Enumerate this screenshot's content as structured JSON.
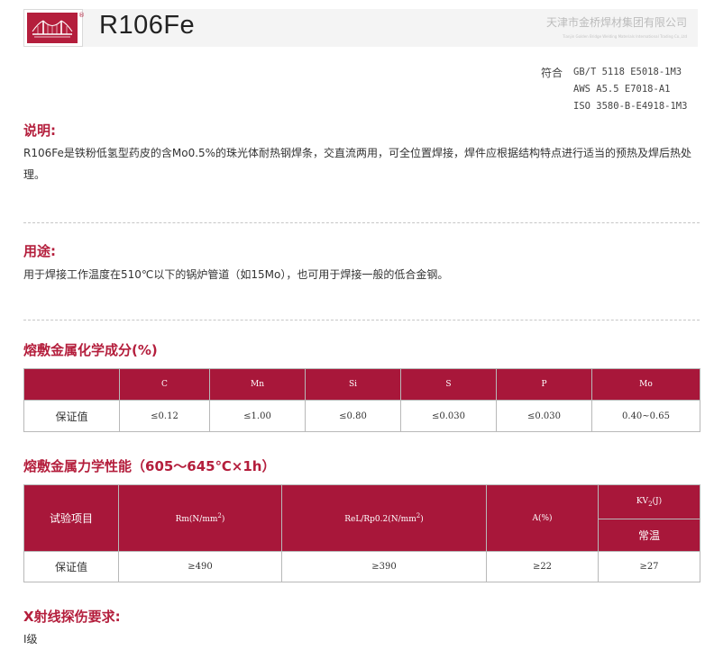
{
  "header": {
    "product_name": "R106Fe",
    "company_cn": "天津市金桥焊材集团有限公司",
    "company_en": "Tianjin Golden Bridge Welding Materials International Trading Co.,Ltd",
    "logo_color": "#b41e3c"
  },
  "standards": {
    "label": "符合",
    "lines": [
      "GB/T 5118 E5018-1M3",
      "AWS A5.5 E7018-A1",
      "ISO 3580-B-E4918-1M3"
    ]
  },
  "description": {
    "title": "说明:",
    "text": "R106Fe是铁粉低氢型药皮的含Mo0.5%的珠光体耐热钢焊条，交直流两用，可全位置焊接，焊件应根据结构特点进行适当的预热及焊后热处理。"
  },
  "usage": {
    "title": "用途:",
    "text": "用于焊接工作温度在510℃以下的锅炉管道（如15Mo），也可用于焊接一般的低合金钢。"
  },
  "chem": {
    "title": "熔敷金属化学成分(%)",
    "headers": [
      "",
      "C",
      "Mn",
      "Si",
      "S",
      "P",
      "Mo"
    ],
    "row_label": "保证值",
    "values": [
      "≤0.12",
      "≤1.00",
      "≤0.80",
      "≤0.030",
      "≤0.030",
      "0.40~0.65"
    ]
  },
  "mech": {
    "title": "熔敷金属力学性能（605～645℃×1h）",
    "col_test": "试验项目",
    "col_rm": "Rm(N/mm",
    "col_rm_sup": "2",
    "col_rm_end": ")",
    "col_rel": "ReL/Rp0.2(N/mm",
    "col_rel_sup": "2",
    "col_rel_end": ")",
    "col_a": "A(%)",
    "col_kv": "KV",
    "col_kv_sub": "2",
    "col_kv_end": "(J)",
    "col_kv_temp": "常温",
    "row_label": "保证值",
    "values": [
      "≥490",
      "≥390",
      "≥22",
      "≥27"
    ]
  },
  "xray": {
    "title": "X射线探伤要求:",
    "text": "I级"
  },
  "colors": {
    "accent": "#b41e3c",
    "table_header": "#a8173a"
  }
}
